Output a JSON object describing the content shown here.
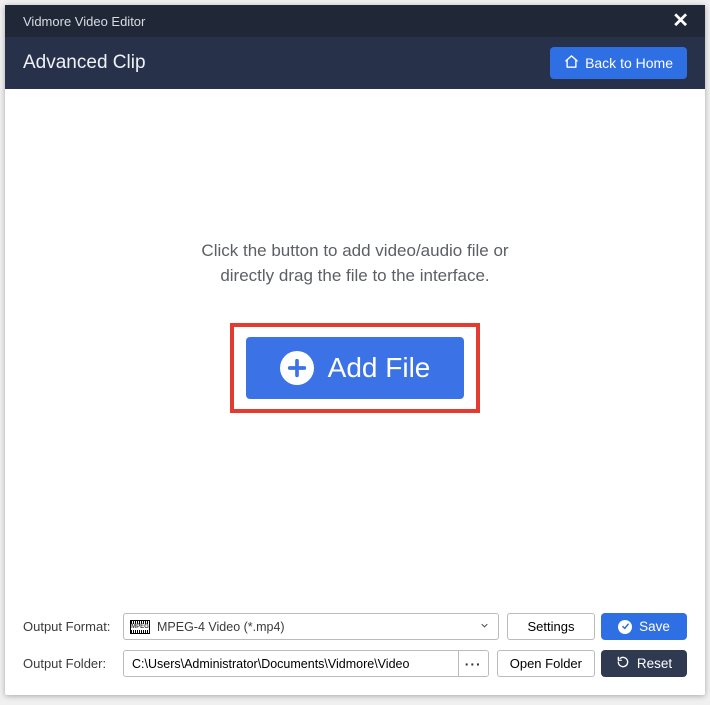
{
  "titlebar": {
    "title": "Vidmore Video Editor"
  },
  "toolbar": {
    "title": "Advanced Clip",
    "home_label": "Back to Home"
  },
  "main": {
    "hint_line1": "Click the button to add video/audio file or",
    "hint_line2": "directly drag the file to the interface.",
    "add_file_label": "Add File"
  },
  "footer": {
    "format_label": "Output Format:",
    "format_value": "MPEG-4 Video (*.mp4)",
    "settings_label": "Settings",
    "folder_label": "Output Folder:",
    "folder_value": "C:\\Users\\Administrator\\Documents\\Vidmore\\Video",
    "browse_label": "···",
    "open_folder_label": "Open Folder",
    "save_label": "Save",
    "reset_label": "Reset"
  }
}
